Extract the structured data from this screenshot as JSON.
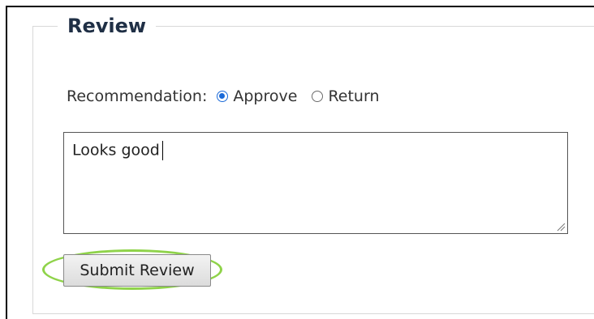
{
  "section": {
    "legend": "Review"
  },
  "recommendation": {
    "label": "Recommendation:",
    "options": [
      {
        "label": "Approve",
        "selected": true
      },
      {
        "label": "Return",
        "selected": false
      }
    ]
  },
  "comment": {
    "value": "Looks good"
  },
  "actions": {
    "submit_label": "Submit Review"
  },
  "colors": {
    "radio_accent": "#1b6ad8",
    "highlight_ring": "#8fd34a"
  }
}
